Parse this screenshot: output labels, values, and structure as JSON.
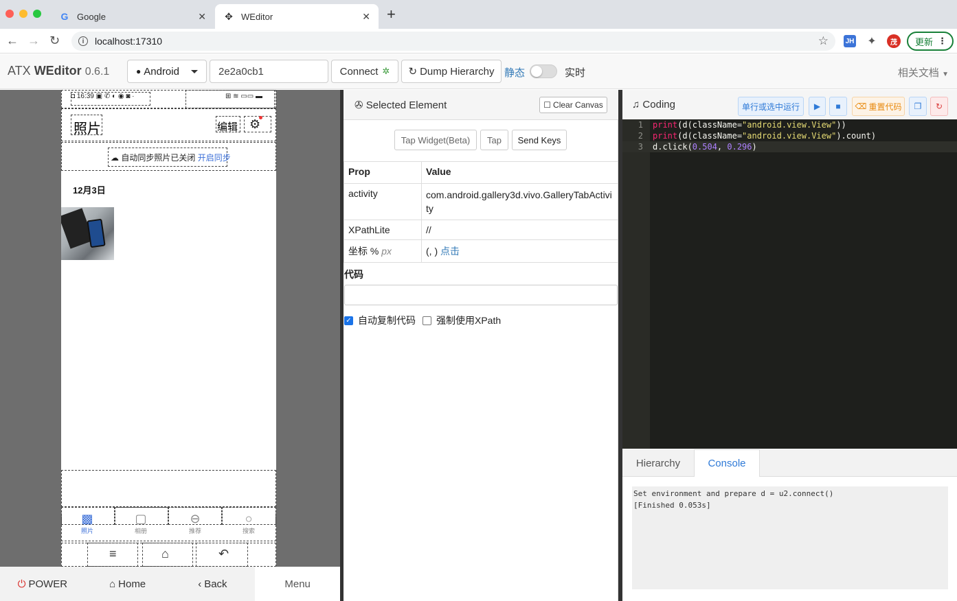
{
  "browser": {
    "tabs": [
      {
        "title": "Google",
        "favicon": "G"
      },
      {
        "title": "WEditor",
        "favicon": "weditor-icon"
      }
    ],
    "url": "localhost:17310",
    "jh_badge": "JH",
    "avatar_initial": "茂",
    "update_label": "更新"
  },
  "app": {
    "brand_prefix": "ATX",
    "brand_name": "WEditor",
    "version": "0.6.1",
    "platform": "Android",
    "serial": "2e2a0cb1",
    "connect_label": "Connect",
    "dump_label": "Dump Hierarchy",
    "static_label": "静态",
    "live_label": "实时",
    "docs_label": "相关文档"
  },
  "device": {
    "status_time": "16:39",
    "photo_title": "照片",
    "edit_label": "编辑",
    "sync_text": "自动同步照片已关闭",
    "sync_link": "开启同步",
    "date_label": "12月3日",
    "tabs": [
      {
        "label": "照片",
        "icon": "photo-icon"
      },
      {
        "label": "相册",
        "icon": "album-icon"
      },
      {
        "label": "推荐",
        "icon": "recommend-icon"
      },
      {
        "label": "搜索",
        "icon": "search-icon"
      }
    ],
    "buttons": {
      "power": "POWER",
      "home": "Home",
      "back": "Back",
      "menu": "Menu"
    }
  },
  "selected": {
    "title": "Selected Element",
    "clear_canvas": "Clear Canvas",
    "actions": {
      "tap_widget": "Tap Widget(Beta)",
      "tap": "Tap",
      "send_keys": "Send Keys"
    },
    "table_headers": {
      "prop": "Prop",
      "value": "Value"
    },
    "rows": {
      "activity_key": "activity",
      "activity_val": "com.android.gallery3d.vivo.GalleryTabActivity",
      "xpath_key": "XPathLite",
      "xpath_val": "//",
      "coord_key": "坐标 %",
      "coord_px": "px",
      "coord_val": "(, )",
      "coord_link": "点击"
    },
    "code_label": "代码",
    "auto_copy": "自动复制代码",
    "force_xpath": "强制使用XPath"
  },
  "coding": {
    "title": "Coding",
    "run_selected": "单行或选中运行",
    "reset_code": "重置代码",
    "tabs": {
      "hierarchy": "Hierarchy",
      "console": "Console"
    },
    "console_lines": [
      "Set environment and prepare d = u2.connect()",
      "[Finished 0.053s]"
    ]
  }
}
